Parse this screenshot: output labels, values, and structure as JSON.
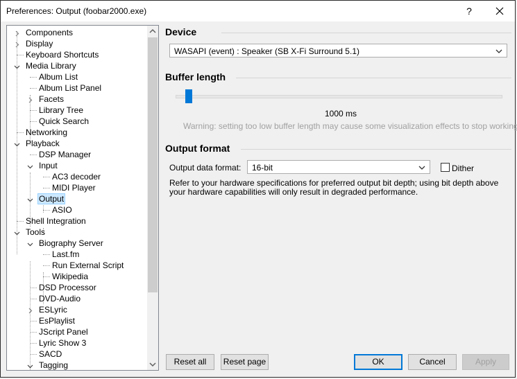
{
  "window": {
    "title": "Preferences: Output (foobar2000.exe)",
    "help_label": "?"
  },
  "tree": {
    "items": [
      {
        "label": "Components",
        "level": 0,
        "expander": "collapsed"
      },
      {
        "label": "Display",
        "level": 0,
        "expander": "collapsed"
      },
      {
        "label": "Keyboard Shortcuts",
        "level": 0,
        "expander": "none"
      },
      {
        "label": "Media Library",
        "level": 0,
        "expander": "expanded"
      },
      {
        "label": "Album List",
        "level": 1,
        "expander": "none"
      },
      {
        "label": "Album List Panel",
        "level": 1,
        "expander": "none"
      },
      {
        "label": "Facets",
        "level": 1,
        "expander": "collapsed"
      },
      {
        "label": "Library Tree",
        "level": 1,
        "expander": "none"
      },
      {
        "label": "Quick Search",
        "level": 1,
        "expander": "none"
      },
      {
        "label": "Networking",
        "level": 0,
        "expander": "none"
      },
      {
        "label": "Playback",
        "level": 0,
        "expander": "expanded"
      },
      {
        "label": "DSP Manager",
        "level": 1,
        "expander": "none"
      },
      {
        "label": "Input",
        "level": 1,
        "expander": "expanded"
      },
      {
        "label": "AC3 decoder",
        "level": 2,
        "expander": "none"
      },
      {
        "label": "MIDI Player",
        "level": 2,
        "expander": "none"
      },
      {
        "label": "Output",
        "level": 1,
        "expander": "expanded",
        "selected": true
      },
      {
        "label": "ASIO",
        "level": 2,
        "expander": "none"
      },
      {
        "label": "Shell Integration",
        "level": 0,
        "expander": "none"
      },
      {
        "label": "Tools",
        "level": 0,
        "expander": "expanded"
      },
      {
        "label": "Biography Server",
        "level": 1,
        "expander": "expanded"
      },
      {
        "label": "Last.fm",
        "level": 2,
        "expander": "none"
      },
      {
        "label": "Run External Script",
        "level": 2,
        "expander": "none"
      },
      {
        "label": "Wikipedia",
        "level": 2,
        "expander": "none"
      },
      {
        "label": "DSD Processor",
        "level": 1,
        "expander": "none"
      },
      {
        "label": "DVD-Audio",
        "level": 1,
        "expander": "none"
      },
      {
        "label": "ESLyric",
        "level": 1,
        "expander": "collapsed"
      },
      {
        "label": "EsPlaylist",
        "level": 1,
        "expander": "none"
      },
      {
        "label": "JScript Panel",
        "level": 1,
        "expander": "none"
      },
      {
        "label": "Lyric Show 3",
        "level": 1,
        "expander": "none"
      },
      {
        "label": "SACD",
        "level": 1,
        "expander": "none"
      },
      {
        "label": "Tagging",
        "level": 1,
        "expander": "expanded"
      }
    ]
  },
  "device": {
    "title": "Device",
    "selected": "WASAPI (event) : Speaker (SB X-Fi Surround 5.1)"
  },
  "buffer": {
    "title": "Buffer length",
    "value_label": "1000 ms",
    "level_fraction": 0.04,
    "warning": "Warning: setting too low buffer length may cause some visualization effects to stop working."
  },
  "output_format": {
    "title": "Output format",
    "format_label": "Output data format:",
    "format_value": "16-bit",
    "dither_label": "Dither",
    "dither_checked": false,
    "note": "Refer to your hardware specifications for preferred output bit depth; using bit depth above your hardware capabilities will only result in degraded performance."
  },
  "buttons": {
    "reset_all": "Reset all",
    "reset_page": "Reset page",
    "ok": "OK",
    "cancel": "Cancel",
    "apply": "Apply"
  },
  "colors": {
    "accent": "#0078d7",
    "selection": "#cce8ff"
  }
}
